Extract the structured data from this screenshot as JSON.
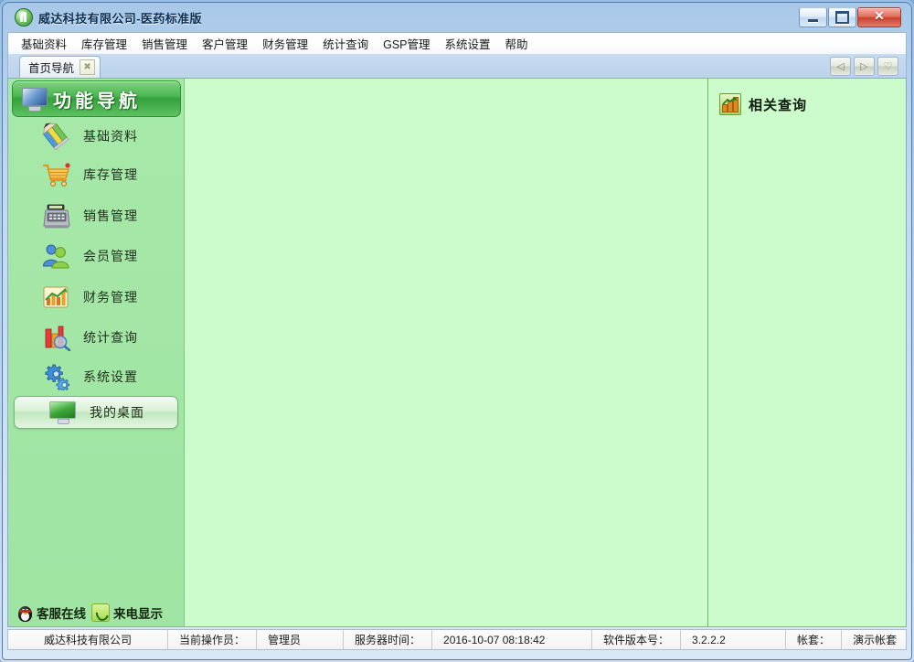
{
  "window": {
    "title": "威达科技有限公司-医药标准版",
    "icon": "app-logo-icon",
    "controls": {
      "minimize": "minimize-icon",
      "maximize": "maximize-icon",
      "close": "✕"
    }
  },
  "menu": {
    "items": [
      {
        "label": "基础资料",
        "name": "menu-basic-data"
      },
      {
        "label": "库存管理",
        "name": "menu-inventory"
      },
      {
        "label": "销售管理",
        "name": "menu-sales"
      },
      {
        "label": "客户管理",
        "name": "menu-customer"
      },
      {
        "label": "财务管理",
        "name": "menu-finance"
      },
      {
        "label": "统计查询",
        "name": "menu-statistics"
      },
      {
        "label": "GSP管理",
        "name": "menu-gsp"
      },
      {
        "label": "系统设置",
        "name": "menu-system-settings"
      },
      {
        "label": "帮助",
        "name": "menu-help"
      }
    ]
  },
  "tabs": {
    "active": "首页导航",
    "close_glyph": "✖",
    "nav": {
      "prev": "◁",
      "next": "▷",
      "list": "♡"
    }
  },
  "sidebar": {
    "header": {
      "label": "功能导航",
      "icon": "monitor-icon"
    },
    "items": [
      {
        "label": "基础资料",
        "icon": "pencils-icon",
        "name": "sidebar-item-basic-data"
      },
      {
        "label": "库存管理",
        "icon": "shopping-cart-icon",
        "name": "sidebar-item-inventory"
      },
      {
        "label": "销售管理",
        "icon": "cash-register-icon",
        "name": "sidebar-item-sales"
      },
      {
        "label": "会员管理",
        "icon": "members-icon",
        "name": "sidebar-item-members"
      },
      {
        "label": "财务管理",
        "icon": "finance-chart-icon",
        "name": "sidebar-item-finance"
      },
      {
        "label": "统计查询",
        "icon": "statistics-magnifier-icon",
        "name": "sidebar-item-statistics"
      },
      {
        "label": "系统设置",
        "icon": "gears-icon",
        "name": "sidebar-item-system-settings"
      }
    ],
    "desktop_button": {
      "label": "我的桌面",
      "icon": "desktop-monitor-icon"
    },
    "bottom": {
      "service": {
        "label": "客服在线",
        "icon": "qq-penguin-icon"
      },
      "caller": {
        "label": "来电显示",
        "icon": "phone-icon"
      }
    }
  },
  "query_panel": {
    "label": "相关查询",
    "icon": "bar-chart-icon"
  },
  "status_bar": {
    "company": "威达科技有限公司",
    "operator_label": "当前操作员：",
    "operator_value": "管理员",
    "server_time_label": "服务器时间：",
    "server_time_value": "2016-10-07 08:18:42",
    "version_label": "软件版本号：",
    "version_value": "3.2.2.2",
    "account_label": "帐套：",
    "account_value": "演示帐套"
  },
  "colors": {
    "frame_blue": "#9cc0e4",
    "client_green": "#ccfbcc",
    "sidebar_green": "#a6e8a8",
    "header_green": "#35a13c",
    "close_red": "#c93f2c"
  }
}
